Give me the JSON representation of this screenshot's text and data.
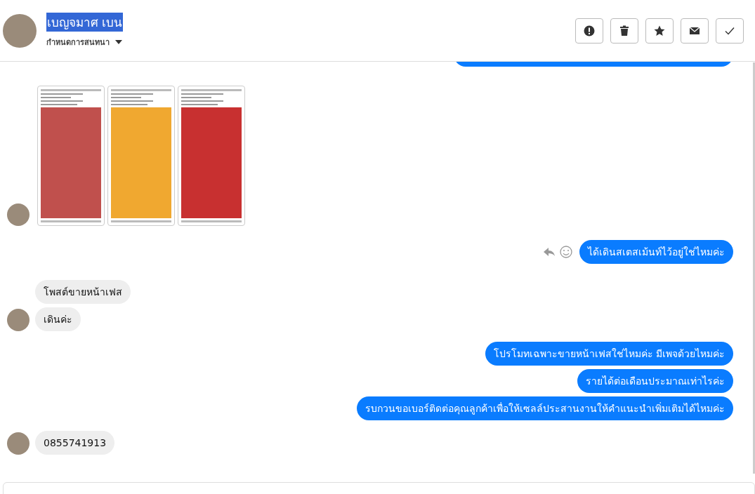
{
  "header": {
    "name": "เบญจมาศ เบน",
    "name_selected": true,
    "subtitle": "กำหนดการสนทนา"
  },
  "messages": [
    {
      "kind": "outgoing_clipped"
    },
    {
      "kind": "images",
      "avatar": true,
      "screens": [
        {
          "kind": "jelly"
        },
        {
          "kind": "products"
        },
        {
          "kind": "promo"
        }
      ]
    },
    {
      "kind": "outgoing",
      "text": "ได้เดินสเตสเม้นท์ไว้อยู่ใช่ไหมค่ะ",
      "hover_actions": true
    },
    {
      "kind": "incoming",
      "text": "โพสต์ขายหน้าเฟส",
      "avatar": false
    },
    {
      "kind": "incoming",
      "text": "เดินค่ะ",
      "avatar": true
    },
    {
      "kind": "outgoing",
      "text": "โปรโมทเฉพาะขายหน้าเฟสใช่ไหมค่ะ มีเพจด้วยไหมค่ะ",
      "hover_actions": false
    },
    {
      "kind": "outgoing",
      "text": "รายได้ต่อเดือนประมาณเท่าไรค่ะ",
      "hover_actions": false
    },
    {
      "kind": "outgoing",
      "text": "รบกวนขอเบอร์ติดต่อคุณลูกค้าเพื่อให้เซลล์ประสานงานให้คำแนะนำเพิ่มเติมได้ไหมค่ะ",
      "hover_actions": false
    },
    {
      "kind": "incoming",
      "text": "0855741913",
      "avatar": true
    }
  ]
}
